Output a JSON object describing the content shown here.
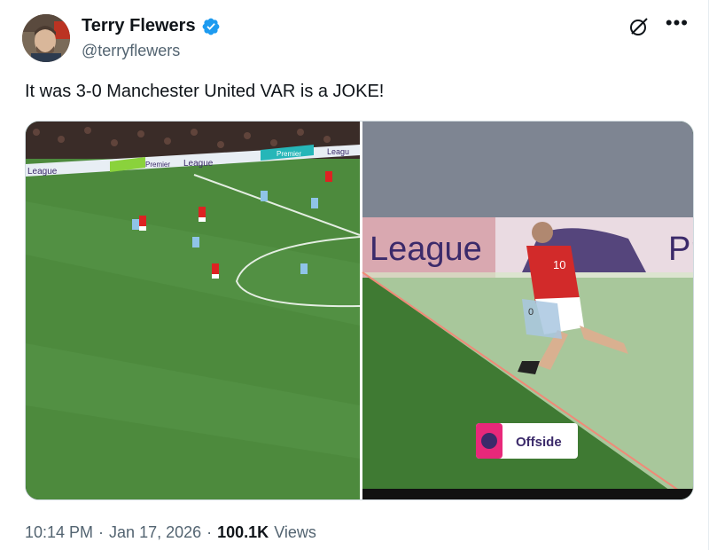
{
  "author": {
    "name": "Terry Flewers",
    "handle": "@terryflewers"
  },
  "tweet": {
    "text": "It was 3-0 Manchester United VAR is a JOKE!"
  },
  "media": {
    "left_frame": {
      "board_texts": [
        "League",
        "Premier",
        "League",
        "Premier",
        "Leagu"
      ]
    },
    "right_frame": {
      "board_text": "League",
      "board_text_2": "Pr",
      "shirt_number": "10",
      "shirt_number_2": "0",
      "badge_label": "Offside"
    }
  },
  "meta": {
    "time": "10:14 PM",
    "date": "Jan 17, 2026",
    "views_count": "100.1K",
    "views_label": "Views",
    "separator": "·"
  },
  "colors": {
    "accent_blue": "#1d9bf0",
    "pitch_green": "#4c8a3c",
    "offside_highlight": "#f08a78"
  }
}
